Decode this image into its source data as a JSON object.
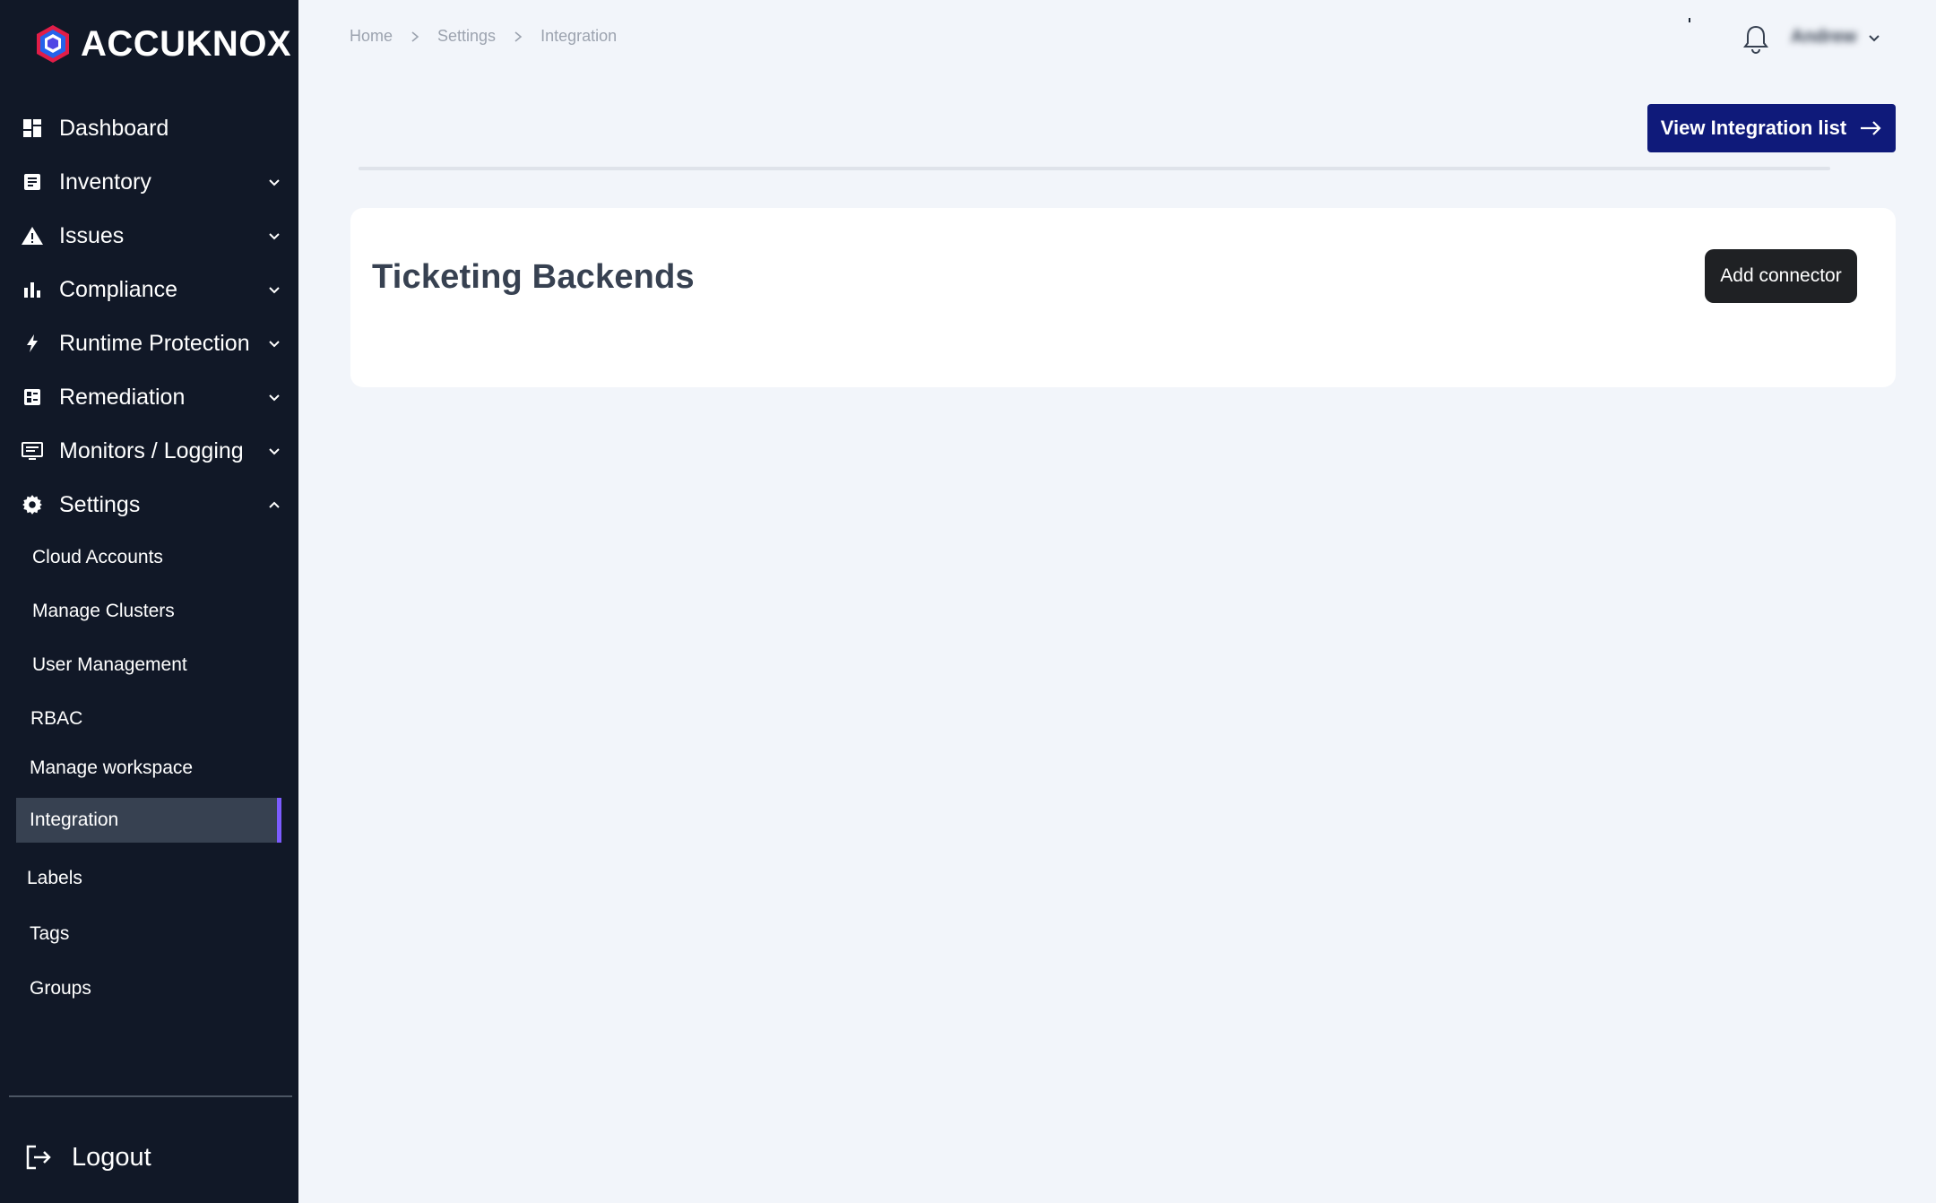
{
  "app": {
    "brand": "ACCUKNOX"
  },
  "sidebar": {
    "items": [
      {
        "label": "Dashboard",
        "icon": "dashboard-icon"
      },
      {
        "label": "Inventory",
        "icon": "inventory-icon"
      },
      {
        "label": "Issues",
        "icon": "warning-icon"
      },
      {
        "label": "Compliance",
        "icon": "bar-chart-icon"
      },
      {
        "label": "Runtime Protection",
        "icon": "bolt-icon"
      },
      {
        "label": "Remediation",
        "icon": "remediation-icon"
      },
      {
        "label": "Monitors / Logging",
        "icon": "monitor-icon"
      },
      {
        "label": "Settings",
        "icon": "gear-icon"
      }
    ],
    "settings_sub": [
      "Cloud Accounts",
      "Manage Clusters",
      "User Management",
      "RBAC",
      "Manage workspace",
      "Integration",
      "Labels",
      "Tags",
      "Groups"
    ],
    "active_sub": "Integration",
    "logout": "Logout"
  },
  "breadcrumb": [
    "Home",
    "Settings",
    "Integration"
  ],
  "header": {
    "user_name": "Andrew"
  },
  "actions": {
    "view_integration": "View Integration list"
  },
  "card": {
    "title": "Ticketing Backends",
    "add_button": "Add connector"
  },
  "colors": {
    "sidebar_bg": "#111827",
    "accent": "#0f1a7a",
    "active_indicator": "#7c5cff",
    "page_bg": "#f2f5fa"
  }
}
